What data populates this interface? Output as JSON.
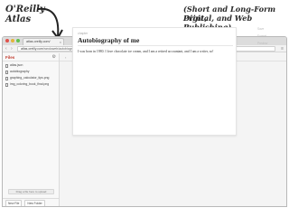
{
  "branding": {
    "name_line1": "O'Reilly",
    "name_line2": "Atlas",
    "tagline_line1": "(Short and Long-Form Print,",
    "tagline_line2": "Digital, and Web Publishing)"
  },
  "browser": {
    "tab_title": "atlas.oreilly.com/",
    "url_host": "atlas.oreilly.com",
    "url_path": "/randoweb/autobiography/editor/chapter-autobiography.html",
    "traffic_lights": [
      "#e0524c",
      "#e3b53a",
      "#62c14f"
    ]
  },
  "sidebar": {
    "title": "Files",
    "files": [
      {
        "name": "atlas.json"
      },
      {
        "name": "autobiography"
      },
      {
        "name": "graphing_calculator_tips.png"
      },
      {
        "name": "img_coloring_book_final.png"
      }
    ],
    "dropzone_text": "Drag a file here to upload",
    "new_file_label": "New File",
    "new_folder_label": "New Folder"
  },
  "document": {
    "label": "chapter",
    "title": "Autobiography of me",
    "paragraph": "I was born in 1980. I love chocolate ice cream, and I am a retired accountant, and I am a writer, so!"
  },
  "right_panel": {
    "items": [
      "Save",
      "Format",
      "Preview"
    ]
  },
  "colors": {
    "accent": "#c0392b"
  }
}
